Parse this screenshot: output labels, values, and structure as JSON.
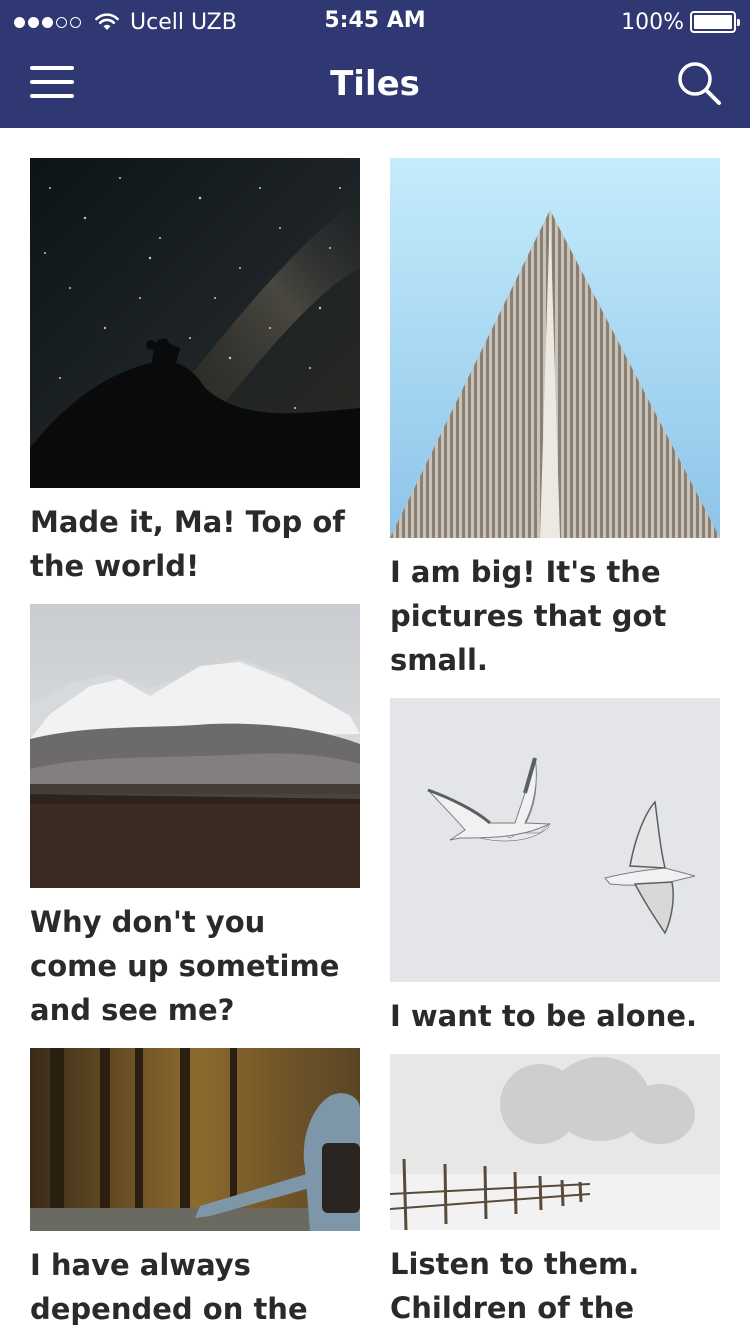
{
  "status_bar": {
    "carrier": "Ucell UZB",
    "time": "5:45 AM",
    "battery": "100%",
    "signal_bars": 3,
    "signal_max": 5
  },
  "nav": {
    "title": "Tiles",
    "menu_icon": "hamburger-icon",
    "search_icon": "search-icon"
  },
  "colors": {
    "header_bg": "#2f3872",
    "caption_text": "#2a2a2a"
  },
  "tiles": {
    "left": [
      {
        "caption": "Made it, Ma! Top of the world!",
        "image": "night-sky-silhouette"
      },
      {
        "caption": "Why don't you come up sometime and see me?",
        "image": "snowy-mountains"
      },
      {
        "caption": "I have always depended on the",
        "image": "hitchhiker-forest"
      }
    ],
    "right": [
      {
        "caption": "I am big! It's the pictures that got small.",
        "image": "skyscraper"
      },
      {
        "caption": "I want to be alone.",
        "image": "seagulls"
      },
      {
        "caption": "Listen to them. Children of the night.",
        "image": "snowy-fence"
      }
    ]
  }
}
